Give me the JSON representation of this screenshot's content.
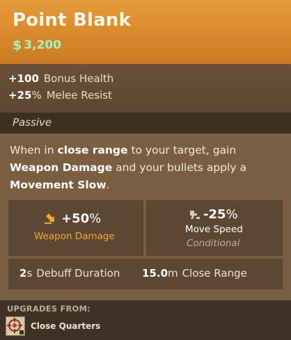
{
  "item": {
    "title": "Point Blank",
    "price_icon": "dollar-icon",
    "price": "3,200"
  },
  "colors": {
    "header": "#d9892c",
    "price": "#a4f3bf",
    "weapon_accent": "#f3a836",
    "body": "#7a5e42"
  },
  "stats": [
    {
      "value": "+100",
      "unit": "",
      "label": "Bonus Health"
    },
    {
      "value": "+25",
      "unit": "%",
      "label": "Melee Resist"
    }
  ],
  "passive": {
    "label": "Passive",
    "desc": {
      "t1": "When in ",
      "b1": "close range",
      "t2": " to your target, gain ",
      "b2": "Weapon Damage",
      "t3": " and your bullets apply a ",
      "b3": "Movement Slow",
      "t4": "."
    },
    "effects": [
      {
        "icon": "weapon-damage-icon",
        "value": "+50",
        "unit": "%",
        "label": "Weapon Damage",
        "note": ""
      },
      {
        "icon": "movement-slow-icon",
        "value": "-25",
        "unit": "%",
        "label": "Move Speed",
        "note": "Conditional"
      }
    ],
    "extras": [
      {
        "value": "2",
        "unit": "s",
        "label": "Debuff Duration"
      },
      {
        "value": "15.0",
        "unit": "m",
        "label": "Close Range"
      }
    ]
  },
  "upgrades": {
    "heading": "UPGRADES FROM:",
    "items": [
      {
        "icon": "close-quarters-icon",
        "name": "Close Quarters"
      }
    ]
  }
}
